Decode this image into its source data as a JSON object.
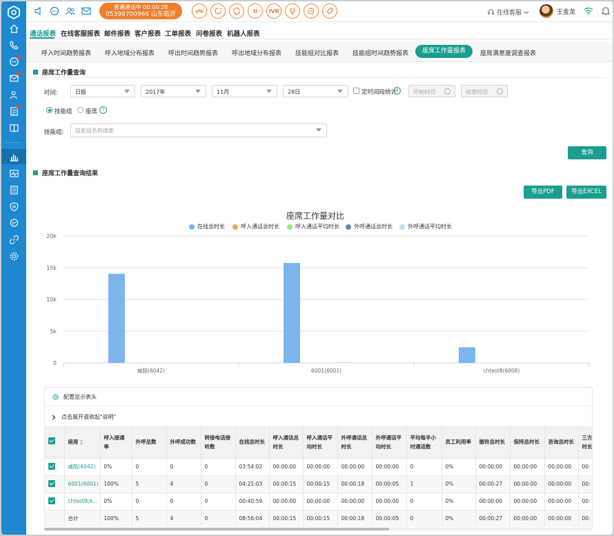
{
  "topbar": {
    "call_status": "普通通话中 00:00:28",
    "call_number": "05398700966 山东临沂",
    "ivr_label": "IVR",
    "agent_status": "在线客服",
    "user_name": "王金龙"
  },
  "nav_main": {
    "tabs": [
      "通话报表",
      "在线客服报表",
      "邮件报表",
      "客户报表",
      "工单报表",
      "问卷报表",
      "机器人报表"
    ],
    "active": "通话报表"
  },
  "nav_sub": {
    "tabs": [
      "呼入时间趋势报表",
      "呼入地域分布报表",
      "呼出时间趋势报表",
      "呼出地域分布报表",
      "技能组对比报表",
      "技能组时间趋势报表",
      "座席工作量报表",
      "座席满意度调查报表"
    ],
    "active": "座席工作量报表"
  },
  "query": {
    "section_title": "座席工作量查询",
    "time_label": "时间:",
    "period": "日报",
    "year": "2017年",
    "month": "11月",
    "day": "28日",
    "time_range_label": "定时间段统计",
    "start_placeholder": "开始时间",
    "end_placeholder": "结束时间",
    "radio_skill": "技能组",
    "radio_agent": "座席",
    "skill_label": "技能组:",
    "skill_placeholder": "技能组名称搜索",
    "search_button": "查询"
  },
  "results": {
    "section_title": "座席工作量查询结果",
    "export_pdf": "导出PDF",
    "export_excel": "导出EXCEL"
  },
  "chart_data": {
    "type": "bar",
    "title": "座席工作量对比",
    "categories": [
      "威陌(6042)",
      "6001(6001)",
      "chtest8(6008)"
    ],
    "series": [
      {
        "name": "在线总时长",
        "color": "#7cb5ec",
        "values": [
          14042,
          15743,
          2459
        ]
      },
      {
        "name": "呼入通话总时长",
        "color": "#f7a35c",
        "values": [
          0,
          0,
          0
        ]
      },
      {
        "name": "呼入通话平均时长",
        "color": "#90ed7d",
        "values": [
          0,
          0,
          0
        ]
      },
      {
        "name": "外呼通话总时长",
        "color": "#6a86a8",
        "values": [
          0,
          18,
          0
        ]
      },
      {
        "name": "外呼通话平均时长",
        "color": "#b3e5f0",
        "values": [
          0,
          5,
          0
        ]
      }
    ],
    "yticks": [
      "0",
      "5k",
      "10k",
      "15k",
      "20k"
    ],
    "ylim": [
      0,
      20000
    ],
    "grid": true,
    "legend": "top"
  },
  "table": {
    "config_label": "配置显示表头",
    "expand_label": "点击展开或收起\"说明\"",
    "headers": [
      "座席",
      "呼入接通率",
      "外呼总数",
      "外呼成功数",
      "转接电话接听数",
      "在线总时长",
      "呼入通话总时长",
      "呼入通话平均时长",
      "外呼通话总时长",
      "外呼通话平均时长",
      "平均每半小时通话数",
      "员工利用率",
      "振铃总时长",
      "保持总时长",
      "咨询总时长",
      "三方通话时长"
    ],
    "rows": [
      [
        "威陌(6042)",
        "0%",
        "0",
        "0",
        "0",
        "03:54:02",
        "00:00:00",
        "00:00:00",
        "00:00:00",
        "00:00:00",
        "0",
        "0%",
        "00:00:00",
        "00:00:00",
        "00:00:00",
        "00:"
      ],
      [
        "6001(6001)",
        "100%",
        "5",
        "4",
        "0",
        "04:21:03",
        "00:00:15",
        "00:00:15",
        "00:00:18",
        "00:00:05",
        "1",
        "0%",
        "00:00:27",
        "00:00:00",
        "00:00:00",
        "00:"
      ],
      [
        "chtest8(6...",
        "0%",
        "0",
        "0",
        "0",
        "00:40:59",
        "00:00:00",
        "00:00:00",
        "00:00:00",
        "00:00:00",
        "0",
        "0%",
        "00:00:00",
        "00:00:00",
        "00:00:00",
        "00:"
      ]
    ],
    "total": [
      "合计",
      "100%",
      "5",
      "4",
      "0",
      "08:56:04",
      "00:00:15",
      "00:00:15",
      "00:00:18",
      "00:00:05",
      "0",
      "0%",
      "00:00:27",
      "00:00:00",
      "00:00:00",
      "00:"
    ]
  }
}
